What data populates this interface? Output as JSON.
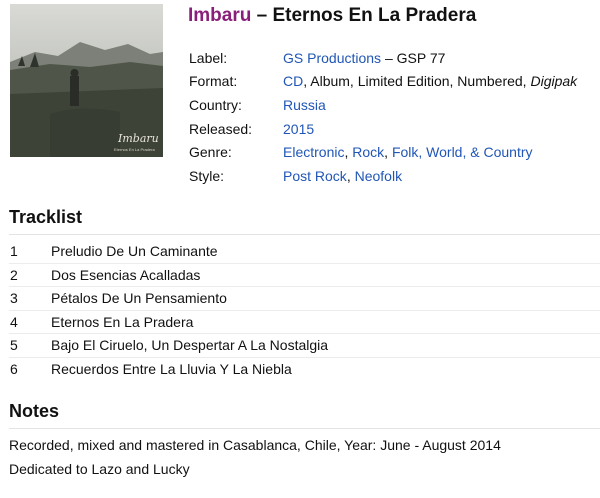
{
  "cover": {
    "logo_text": "Imbaru",
    "subtitle_text": "Eternos En La Pradera"
  },
  "header": {
    "artist": "Imbaru",
    "separator": " – ",
    "album": "Eternos En La Pradera"
  },
  "info": {
    "label": {
      "key": "Label:",
      "link": "GS Productions",
      "rest": " – GSP 77"
    },
    "format": {
      "key": "Format:",
      "link": "CD",
      "rest": ", Album, Limited Edition, Numbered, ",
      "italic": "Digipak"
    },
    "country": {
      "key": "Country:",
      "link": "Russia"
    },
    "released": {
      "key": "Released:",
      "link": "2015"
    },
    "genre": {
      "key": "Genre:",
      "links": [
        "Electronic",
        "Rock",
        "Folk, World, & Country"
      ],
      "sep": ", "
    },
    "style": {
      "key": "Style:",
      "links": [
        "Post Rock",
        "Neofolk"
      ],
      "sep": ", "
    }
  },
  "tracklist": {
    "heading": "Tracklist",
    "tracks": [
      {
        "pos": "1",
        "title": "Preludio De Un Caminante"
      },
      {
        "pos": "2",
        "title": "Dos Esencias Acalladas"
      },
      {
        "pos": "3",
        "title": "Pétalos De Un Pensamiento"
      },
      {
        "pos": "4",
        "title": "Eternos En La Pradera"
      },
      {
        "pos": "5",
        "title": "Bajo El Ciruelo, Un Despertar A La Nostalgia"
      },
      {
        "pos": "6",
        "title": "Recuerdos Entre La Lluvia Y La Niebla"
      }
    ]
  },
  "notes": {
    "heading": "Notes",
    "lines": [
      "Recorded, mixed and mastered in Casablanca, Chile, Year: June - August 2014",
      "Dedicated to Lazo and Lucky"
    ]
  },
  "colors": {
    "artist": "#8a1f7b",
    "link": "#2156b6"
  }
}
